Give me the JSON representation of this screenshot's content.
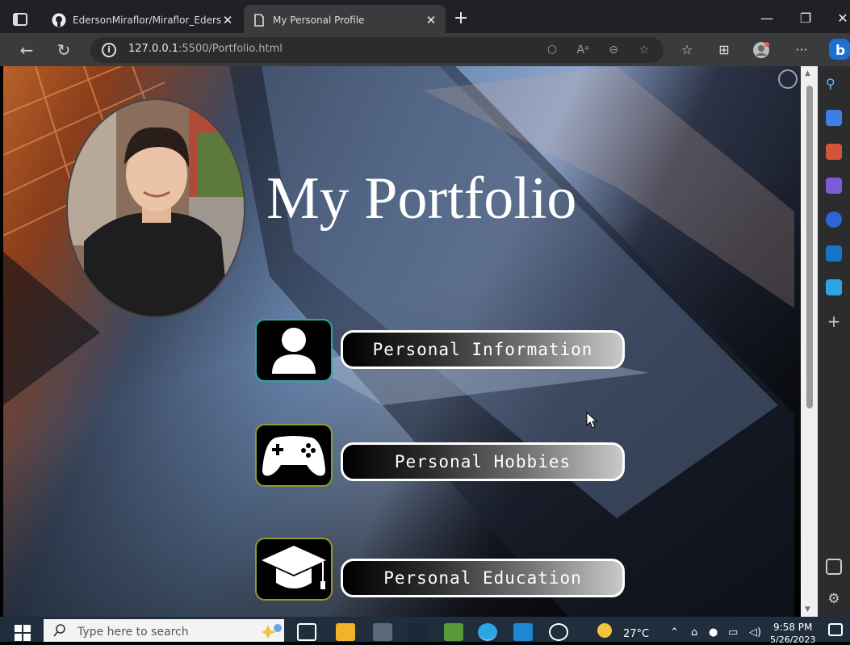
{
  "browser": {
    "tabs": [
      {
        "title": "EdersonMiraflor/Miraflor_Ederso",
        "icon": "github-icon",
        "active": false
      },
      {
        "title": "My Personal Profile",
        "icon": "page-icon",
        "active": true
      }
    ],
    "url_host": "127.0.0.1",
    "url_rest": ":5500/Portfolio.html"
  },
  "page": {
    "title": "My Portfolio",
    "menu": [
      {
        "label": "Personal Information",
        "icon": "person-icon"
      },
      {
        "label": "Personal Hobbies",
        "icon": "gamepad-icon"
      },
      {
        "label": "Personal Education",
        "icon": "graduation-cap-icon"
      }
    ]
  },
  "taskbar": {
    "search_placeholder": "Type here to search",
    "weather": "27°C",
    "time": "9:58 PM",
    "date": "5/26/2023"
  }
}
